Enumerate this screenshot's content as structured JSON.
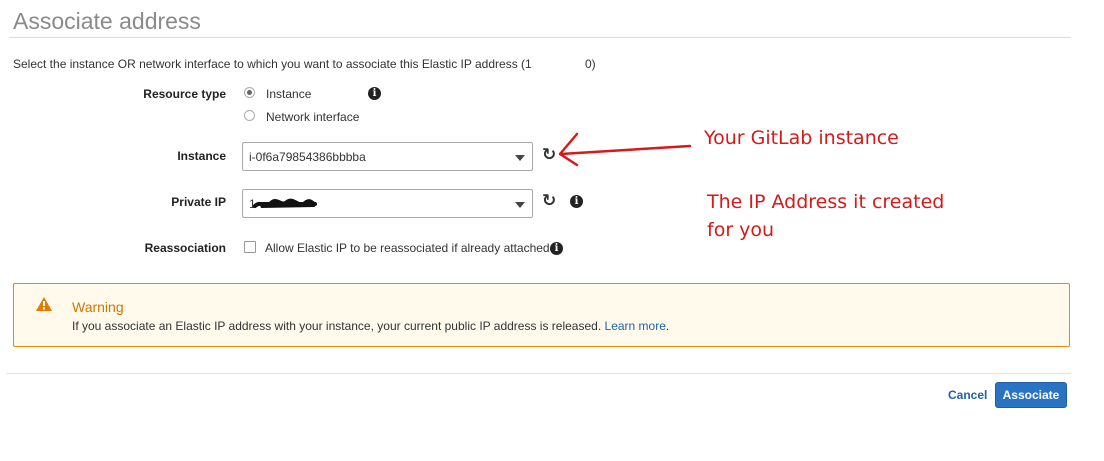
{
  "page": {
    "title": "Associate address",
    "description": "Select the instance OR network interface to which you want to associate this Elastic IP address (1",
    "description_tail": "0)"
  },
  "form": {
    "resource_type": {
      "label": "Resource type",
      "options": [
        "Instance",
        "Network interface"
      ],
      "selected": "Instance"
    },
    "instance": {
      "label": "Instance",
      "value": "i-0f6a79854386bbbba"
    },
    "private_ip": {
      "label": "Private IP",
      "value": "1"
    },
    "reassociation": {
      "label": "Reassociation",
      "checkbox_label": "Allow Elastic IP to be reassociated if already attached",
      "checked": false
    }
  },
  "warning": {
    "title": "Warning",
    "text": "If you associate an Elastic IP address with your instance, your current public IP address is released.",
    "link": "Learn more",
    "after_link": "."
  },
  "footer": {
    "cancel_label": "Cancel",
    "associate_label": "Associate"
  },
  "annotations": {
    "instance_note": "Your GitLab instance",
    "ip_note_line1": "The IP Address it created",
    "ip_note_line2": "for you"
  },
  "colors": {
    "accent": "#2a72c2",
    "warning_border": "#e88b00",
    "warning_bg": "#fffaec",
    "annotation": "#d41a1a"
  },
  "icons": {
    "info": "info-icon",
    "refresh": "refresh-icon",
    "warning": "warning-triangle-icon",
    "dropdown": "chevron-down-icon"
  }
}
